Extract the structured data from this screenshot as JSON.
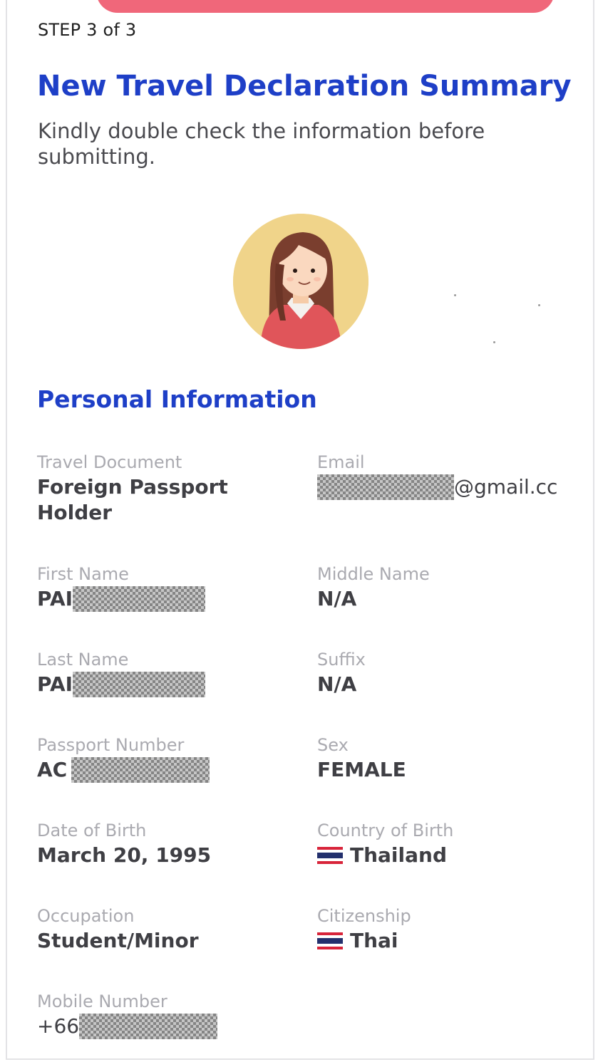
{
  "header": {
    "step": "STEP 3 of 3",
    "title": "New Travel Declaration Summary",
    "subtitle": "Kindly double check the information before submitting."
  },
  "section": {
    "title": "Personal Information"
  },
  "fields": {
    "travel_document": {
      "label": "Travel Document",
      "value": "Foreign Passport Holder"
    },
    "email": {
      "label": "Email",
      "value_suffix": "@gmail.cc"
    },
    "first_name": {
      "label": "First Name",
      "value_prefix": "PAI"
    },
    "middle_name": {
      "label": "Middle Name",
      "value": "N/A"
    },
    "last_name": {
      "label": "Last Name",
      "value_prefix": "PAI"
    },
    "suffix": {
      "label": "Suffix",
      "value": "N/A"
    },
    "passport_number": {
      "label": "Passport Number",
      "value_prefix": "AC"
    },
    "sex": {
      "label": "Sex",
      "value": "FEMALE"
    },
    "date_of_birth": {
      "label": "Date of Birth",
      "value": "March 20, 1995"
    },
    "country_of_birth": {
      "label": "Country of Birth",
      "value": "Thailand",
      "flag": "thailand-flag"
    },
    "occupation": {
      "label": "Occupation",
      "value": "Student/Minor"
    },
    "citizenship": {
      "label": "Citizenship",
      "value": "Thai",
      "flag": "thailand-flag"
    },
    "mobile_number": {
      "label": "Mobile Number",
      "value_prefix": "+66"
    }
  },
  "colors": {
    "accent": "#1e3fc7",
    "top_bar": "#f0677a",
    "avatar_bg": "#f0d48a"
  }
}
